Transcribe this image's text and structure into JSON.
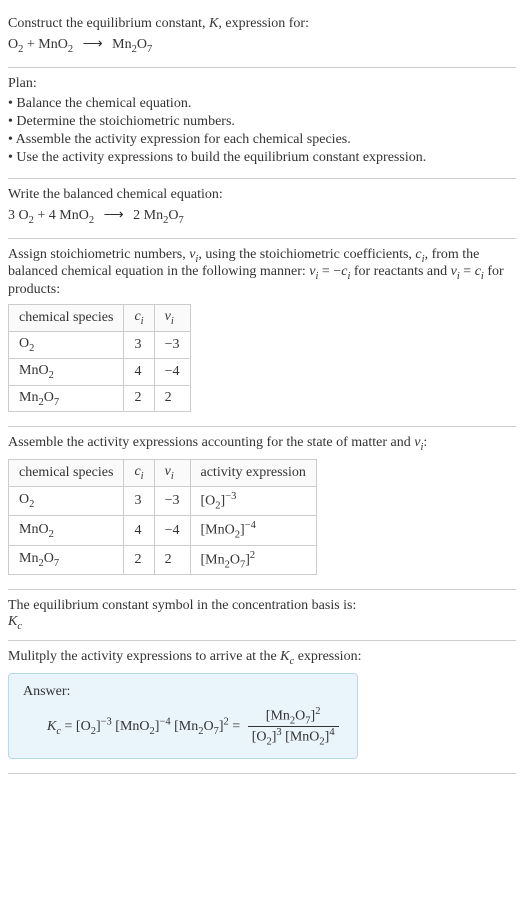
{
  "prompt": {
    "line1": "Construct the equilibrium constant, ",
    "K": "K",
    "line1_end": ", expression for:",
    "reactant1": "O",
    "reactant1_sub": "2",
    "plus": " + ",
    "reactant2": "MnO",
    "reactant2_sub": "2",
    "arrow": "⟶",
    "product1": "Mn",
    "product1_sub1": "2",
    "product1_mid": "O",
    "product1_sub2": "7"
  },
  "plan": {
    "title": "Plan:",
    "b1": "• Balance the chemical equation.",
    "b2": "• Determine the stoichiometric numbers.",
    "b3": "• Assemble the activity expression for each chemical species.",
    "b4": "• Use the activity expressions to build the equilibrium constant expression."
  },
  "balanced": {
    "title": "Write the balanced chemical equation:",
    "c1": "3 O",
    "c1_sub": "2",
    "plus": " + ",
    "c2": "4 MnO",
    "c2_sub": "2",
    "arrow": "⟶",
    "c3": "2 Mn",
    "c3_sub1": "2",
    "c3_mid": "O",
    "c3_sub2": "7"
  },
  "stoich": {
    "intro1": "Assign stoichiometric numbers, ",
    "nu": "ν",
    "i": "i",
    "intro2": ", using the stoichiometric coefficients, ",
    "c": "c",
    "intro3": ", from the balanced chemical equation in the following manner: ",
    "eq1a": "ν",
    "eq1b": " = −",
    "eq1c": "c",
    "intro4": " for reactants and ",
    "eq2a": "ν",
    "eq2b": " = ",
    "eq2c": "c",
    "intro5": " for products:",
    "table": {
      "h1": "chemical species",
      "h2": "c",
      "h2_sub": "i",
      "h3": "ν",
      "h3_sub": "i",
      "rows": [
        {
          "s1": "O",
          "s1_sub": "2",
          "c": "3",
          "nu": "−3"
        },
        {
          "s2": "MnO",
          "s2_sub": "2",
          "c": "4",
          "nu": "−4"
        },
        {
          "s3a": "Mn",
          "s3_sub1": "2",
          "s3b": "O",
          "s3_sub2": "7",
          "c": "2",
          "nu": "2"
        }
      ]
    }
  },
  "activity": {
    "intro1": "Assemble the activity expressions accounting for the state of matter and ",
    "nu": "ν",
    "i": "i",
    "intro2": ":",
    "table": {
      "h1": "chemical species",
      "h2": "c",
      "h2_sub": "i",
      "h3": "ν",
      "h3_sub": "i",
      "h4": "activity expression",
      "rows": [
        {
          "s": "O",
          "s_sub": "2",
          "c": "3",
          "nu": "−3",
          "a1": "[O",
          "a1_sub": "2",
          "a1_end": "]",
          "a1_sup": "−3"
        },
        {
          "s": "MnO",
          "s_sub": "2",
          "c": "4",
          "nu": "−4",
          "a2": "[MnO",
          "a2_sub": "2",
          "a2_end": "]",
          "a2_sup": "−4"
        },
        {
          "s3a": "Mn",
          "s3_sub1": "2",
          "s3b": "O",
          "s3_sub2": "7",
          "c": "2",
          "nu": "2",
          "a3a": "[Mn",
          "a3_sub1": "2",
          "a3b": "O",
          "a3_sub2": "7",
          "a3_end": "]",
          "a3_sup": "2"
        }
      ]
    }
  },
  "symbol": {
    "line": "The equilibrium constant symbol in the concentration basis is:",
    "K": "K",
    "c": "c"
  },
  "multiply": {
    "line1": "Mulitply the activity expressions to arrive at the ",
    "K": "K",
    "c": "c",
    "line2": " expression:"
  },
  "answer": {
    "label": "Answer:",
    "Kc_K": "K",
    "Kc_c": "c",
    "eq": " = ",
    "t1": "[O",
    "t1_sub": "2",
    "t1_end": "]",
    "t1_sup": "−3",
    "sp": " ",
    "t2": "[MnO",
    "t2_sub": "2",
    "t2_end": "]",
    "t2_sup": "−4",
    "t3a": "[Mn",
    "t3_sub1": "2",
    "t3b": "O",
    "t3_sub2": "7",
    "t3_end": "]",
    "t3_sup": "2",
    "eq2": " = ",
    "num_a": "[Mn",
    "num_sub1": "2",
    "num_b": "O",
    "num_sub2": "7",
    "num_end": "]",
    "num_sup": "2",
    "den1": "[O",
    "den1_sub": "2",
    "den1_end": "]",
    "den1_sup": "3",
    "den2": "[MnO",
    "den2_sub": "2",
    "den2_end": "]",
    "den2_sup": "4"
  }
}
